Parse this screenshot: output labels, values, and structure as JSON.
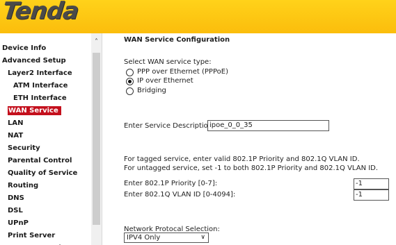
{
  "brand": {
    "logo_text": "Tenda",
    "header_color": "#fcc60f"
  },
  "sidebar": {
    "items": [
      {
        "label": "Device Info",
        "level": 0,
        "active": false
      },
      {
        "label": "Advanced Setup",
        "level": 0,
        "active": false
      },
      {
        "label": "Layer2 Interface",
        "level": 1,
        "active": false
      },
      {
        "label": "ATM Interface",
        "level": 2,
        "active": false
      },
      {
        "label": "ETH Interface",
        "level": 2,
        "active": false
      },
      {
        "label": "WAN Service",
        "level": 1,
        "active": true
      },
      {
        "label": "LAN",
        "level": 1,
        "active": false
      },
      {
        "label": "NAT",
        "level": 1,
        "active": false
      },
      {
        "label": "Security",
        "level": 1,
        "active": false
      },
      {
        "label": "Parental Control",
        "level": 1,
        "active": false
      },
      {
        "label": "Quality of Service",
        "level": 1,
        "active": false
      },
      {
        "label": "Routing",
        "level": 1,
        "active": false
      },
      {
        "label": "DNS",
        "level": 1,
        "active": false
      },
      {
        "label": "DSL",
        "level": 1,
        "active": false
      },
      {
        "label": "UPnP",
        "level": 1,
        "active": false
      },
      {
        "label": "Print Server",
        "level": 1,
        "active": false
      },
      {
        "label": "Storage Service",
        "level": 1,
        "active": false
      }
    ],
    "active_color": "#c4101d",
    "scroll_up_icon": "chevron-up-icon"
  },
  "main": {
    "title": "WAN Service Configuration",
    "select_label": "Select WAN service type:",
    "options": [
      {
        "label": "PPP over Ethernet (PPPoE)",
        "checked": false
      },
      {
        "label": "IP over Ethernet",
        "checked": true
      },
      {
        "label": "Bridging",
        "checked": false
      }
    ],
    "description_label": "Enter Service Description:",
    "description_value": "ipoe_0_0_35",
    "tagged_info": "For tagged service, enter valid 802.1P Priority and 802.1Q VLAN ID.",
    "untagged_info": "For untagged service, set -1 to both 802.1P Priority and 802.1Q VLAN ID.",
    "priority_label": "Enter 802.1P Priority [0-7]:",
    "priority_value": "-1",
    "vlan_label": "Enter 802.1Q VLAN ID [0-4094]:",
    "vlan_value": "-1",
    "protocol_label": "Network Protocal Selection:",
    "protocol_value": "IPV4 Only"
  }
}
